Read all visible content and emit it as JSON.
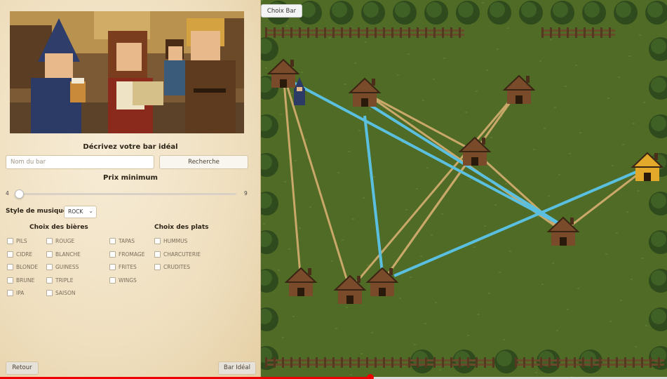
{
  "form": {
    "heading": "Décrivez votre bar idéal",
    "search_placeholder": "Nom du bar",
    "search_button": "Recherche",
    "price_title": "Prix minimum",
    "price_min_label": "4",
    "price_max_label": "9",
    "price_value": 4,
    "music_label": "Style de musique",
    "music_selected": "ROCK",
    "beers_title": "Choix des bières",
    "dishes_title": "Choix des plats",
    "beers_col1": [
      "PILS",
      "CIDRE",
      "BLONDE",
      "BRUNE",
      "IPA"
    ],
    "beers_col2": [
      "ROUGE",
      "BLANCHE",
      "GUINESS",
      "TRIPLE",
      "SAISON"
    ],
    "dishes_col1": [
      "TAPAS",
      "FROMAGE",
      "FRITES",
      "WINGS"
    ],
    "dishes_col2": [
      "HUMMUS",
      "CHARCUTERIE",
      "CRUDITES"
    ],
    "back_button": "Retour",
    "ideal_button": "Bar Idéal"
  },
  "map": {
    "tab_label": "Choix Bar",
    "colors": {
      "grass": "#4f6b25",
      "route": "#5bbfe0",
      "link": "#c9a86a",
      "bar": "#7a4b2b",
      "bar_selected": "#e3a92a"
    }
  },
  "video_progress": 0.555
}
